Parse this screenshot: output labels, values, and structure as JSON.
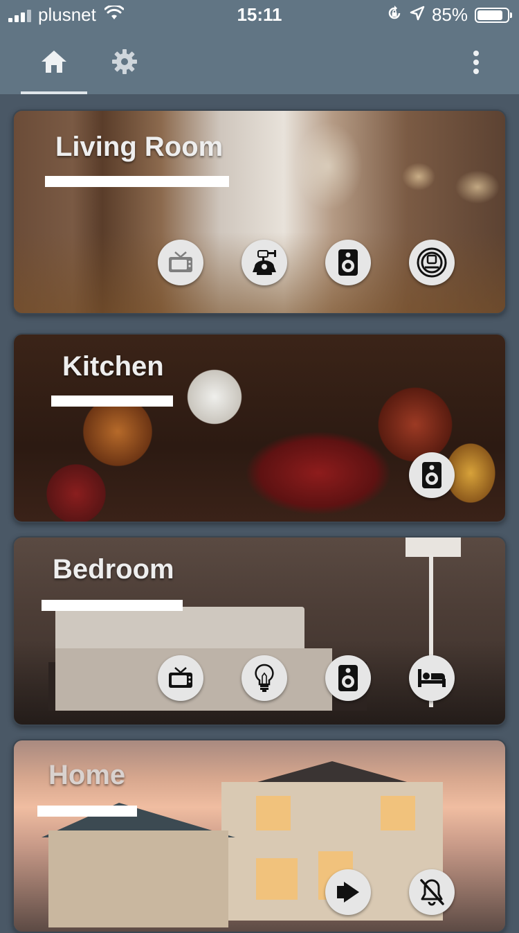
{
  "status_bar": {
    "carrier": "plusnet",
    "time": "15:11",
    "battery_percent": "85%",
    "battery_level": 0.85,
    "icons": [
      "signal-icon",
      "wifi-icon",
      "orientation-lock-icon",
      "location-icon",
      "battery-icon"
    ]
  },
  "app_bar": {
    "tabs": [
      {
        "name": "home",
        "icon": "home-icon",
        "selected": true
      },
      {
        "name": "settings",
        "icon": "gear-icon",
        "selected": false
      }
    ],
    "menu_icon": "more-vertical-icon",
    "colors": {
      "bar": "#617584",
      "indicator": "#dfe5ea"
    }
  },
  "rooms": [
    {
      "title": "Living Room",
      "devices": [
        "tv-icon",
        "robot-icon",
        "speaker-icon",
        "robot-vacuum-icon"
      ]
    },
    {
      "title": "Kitchen",
      "devices": [
        "speaker-icon"
      ]
    },
    {
      "title": "Bedroom",
      "devices": [
        "tv-icon",
        "light-bulb-icon",
        "speaker-icon",
        "bed-icon"
      ]
    },
    {
      "title": "Home",
      "devices": [
        "sign-out-icon",
        "bell-slash-icon"
      ]
    }
  ]
}
